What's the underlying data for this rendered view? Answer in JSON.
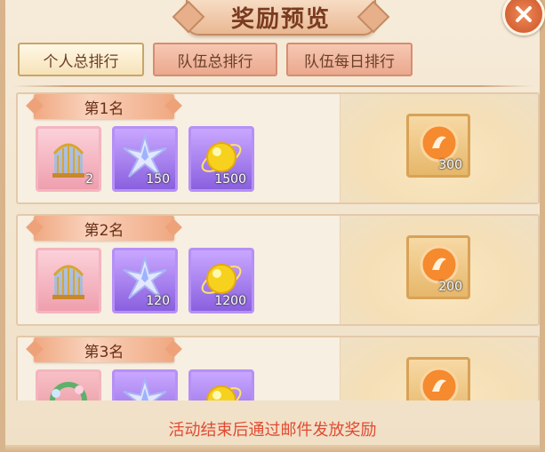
{
  "title": "奖励预览",
  "tabs": [
    {
      "label": "个人总排行",
      "active": true
    },
    {
      "label": "队伍总排行",
      "active": false
    },
    {
      "label": "队伍每日排行",
      "active": false
    }
  ],
  "ranks": [
    {
      "label": "第1名",
      "items": [
        "2",
        "150",
        "1500"
      ],
      "box": "300"
    },
    {
      "label": "第2名",
      "items": [
        "",
        "120",
        "1200"
      ],
      "box": "200"
    },
    {
      "label": "第3名",
      "items": [
        "",
        "",
        ""
      ],
      "box": ""
    }
  ],
  "footer": "活动结束后通过邮件发放奖励",
  "icons": {
    "close": "close-icon",
    "birdcage": "birdcage-icon",
    "crystal": "crystal-shard-icon",
    "gold_orb": "gold-orb-icon",
    "orange_orb": "orange-orb-icon",
    "wreath": "flower-wreath-icon"
  },
  "colors": {
    "accent": "#e24a32",
    "title_text": "#7a3b20",
    "tab_text": "#6a3f26"
  }
}
